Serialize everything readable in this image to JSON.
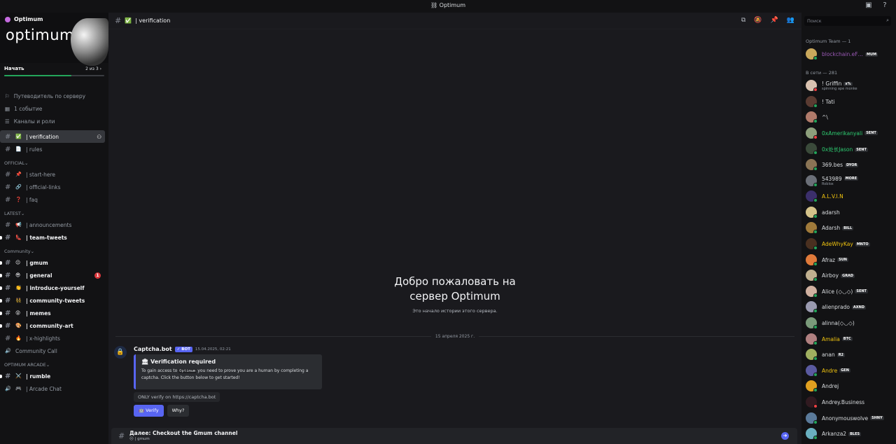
{
  "titlebar": {
    "title": "Optimum"
  },
  "server": {
    "name": "Optimum",
    "logo_text": "optimum"
  },
  "onboarding": {
    "label": "Начать",
    "count": "2 из 3",
    "progress": 0.67
  },
  "nav": [
    {
      "label": "Путеводитель по серверу",
      "icon": "signpost-icon"
    },
    {
      "label": "1 событие",
      "icon": "calendar-icon"
    },
    {
      "label": "Каналы и роли",
      "icon": "channels-roles-icon"
    }
  ],
  "channels_top": [
    {
      "emoji": "✅",
      "label": "| verification",
      "active": true
    },
    {
      "emoji": "📄",
      "label": "| rules"
    }
  ],
  "categories": [
    {
      "name": "OFFICIAL",
      "channels": [
        {
          "emoji": "📌",
          "label": "| start-here"
        },
        {
          "emoji": "🔗",
          "label": "| official-links"
        },
        {
          "emoji": "❓",
          "label": "| faq"
        }
      ]
    },
    {
      "name": "LATEST",
      "channels": [
        {
          "emoji": "📢",
          "label": "| announcements"
        },
        {
          "emoji": "👠",
          "label": "| team-tweets",
          "bold": true
        }
      ]
    },
    {
      "name": "Community",
      "channels": [
        {
          "emoji": "😐",
          "label": "| gmum",
          "bold": true
        },
        {
          "emoji": "😎",
          "label": "| general",
          "bold": true,
          "badge": "1"
        },
        {
          "emoji": "👏",
          "label": "| introduce-yourself",
          "bold": true
        },
        {
          "emoji": "👯",
          "label": "| community-tweets",
          "bold": true
        },
        {
          "emoji": "😵",
          "label": "| memes",
          "bold": true
        },
        {
          "emoji": "🎨",
          "label": "| community-art",
          "bold": true
        },
        {
          "emoji": "🔥",
          "label": "| x-highlights"
        },
        {
          "emoji": "",
          "label": "Community Call",
          "voice": true
        }
      ]
    },
    {
      "name": "OPTIMUM ARCADE",
      "channels": [
        {
          "emoji": "⚔️",
          "label": "| rumble",
          "bold": true
        },
        {
          "emoji": "🎮",
          "label": "| Arcade Chat",
          "voice": true
        }
      ]
    }
  ],
  "channel_header": {
    "emoji": "✅",
    "name": "| verification"
  },
  "welcome": {
    "title": "Добро пожаловать на сервер Optimum",
    "subtitle": "Это начало истории этого сервера."
  },
  "date_separator": "15 апреля 2025 г.",
  "message": {
    "author": "Captcha.bot",
    "bot_badge": "✓ BOT",
    "timestamp": "15.04.2025, 02:21",
    "embed_title": "🏛 Verification required",
    "embed_desc_1": "To gain access to",
    "embed_code": "Optimum",
    "embed_desc_2": "you need to prove you are a human by completing a captcha. Click the button below to get started!",
    "only_verify": "ONLY verify on https://captcha.bot",
    "verify_label": "🤖 Verify",
    "why_label": "Why?"
  },
  "next_bar": {
    "title": "Далее: Checkout the Gmum channel",
    "subtitle": "😐 | gmum"
  },
  "search": {
    "placeholder": "Поиск"
  },
  "member_groups": [
    {
      "label": "Optimum Team — 1"
    },
    {
      "label": "В сети — 281"
    }
  ],
  "members": [
    {
      "name": "blockchain.eF…",
      "tag": "MUM",
      "color": "#9b59b6",
      "status": "#23a55a"
    },
    {
      "name": "! Griffin",
      "tag": "x%",
      "sub": "spinning ape monke",
      "color": "#dbdee1",
      "status": "#f23f43"
    },
    {
      "name": "! Tati",
      "color": "#dbdee1",
      "status": "#23a55a"
    },
    {
      "name": "^\\",
      "color": "#dbdee1",
      "status": "#23a55a"
    },
    {
      "name": "0xAmerikanyali",
      "tag": "SENT",
      "color": "#2ecc71",
      "status": "#f23f43"
    },
    {
      "name": "0x处长Jason",
      "tag": "SENT",
      "color": "#2ecc71",
      "status": "#23a55a"
    },
    {
      "name": "369.bes",
      "tag": "DYOR",
      "color": "#dbdee1",
      "status": "#23a55a"
    },
    {
      "name": "543989",
      "tag": "MORE",
      "sub": "Roblox",
      "color": "#dbdee1",
      "status": "#23a55a"
    },
    {
      "name": "A.L.V.I.N",
      "color": "#f1c40f",
      "status": "#23a55a"
    },
    {
      "name": "adarsh",
      "color": "#dbdee1",
      "status": "#23a55a"
    },
    {
      "name": "Adarsh",
      "tag": "BILL",
      "color": "#dbdee1",
      "status": "#23a55a"
    },
    {
      "name": "AdeWhyKay",
      "tag": "MNTO",
      "color": "#f1c40f",
      "status": "#23a55a"
    },
    {
      "name": "Afraz",
      "tag": "SUN",
      "color": "#dbdee1",
      "status": "#23a55a"
    },
    {
      "name": "Airboy",
      "tag": "GRAD",
      "color": "#dbdee1",
      "status": "#23a55a"
    },
    {
      "name": "Alice (◇◡◇)",
      "tag": "SENT",
      "color": "#dbdee1",
      "status": "#23a55a"
    },
    {
      "name": "alienprado",
      "tag": "AXND",
      "color": "#dbdee1",
      "status": "#23a55a"
    },
    {
      "name": "alinna(◇◡◇)",
      "color": "#dbdee1",
      "status": "#23a55a"
    },
    {
      "name": "Amalia",
      "tag": "BTC",
      "color": "#f1c40f",
      "status": "#23a55a"
    },
    {
      "name": "anan",
      "tag": "R2",
      "color": "#dbdee1",
      "status": "#23a55a"
    },
    {
      "name": "Andre",
      "tag": "GEN",
      "color": "#f1c40f",
      "status": "#23a55a"
    },
    {
      "name": "Andrej",
      "color": "#dbdee1",
      "status": "#23a55a"
    },
    {
      "name": "Andrey.Business",
      "color": "#dbdee1",
      "status": "#f23f43"
    },
    {
      "name": "Anonymouswolve",
      "tag": "SHNY",
      "color": "#dbdee1",
      "status": "#23a55a"
    },
    {
      "name": "Arkanza2",
      "tag": "BLES",
      "color": "#dbdee1",
      "status": "#23a55a"
    }
  ]
}
